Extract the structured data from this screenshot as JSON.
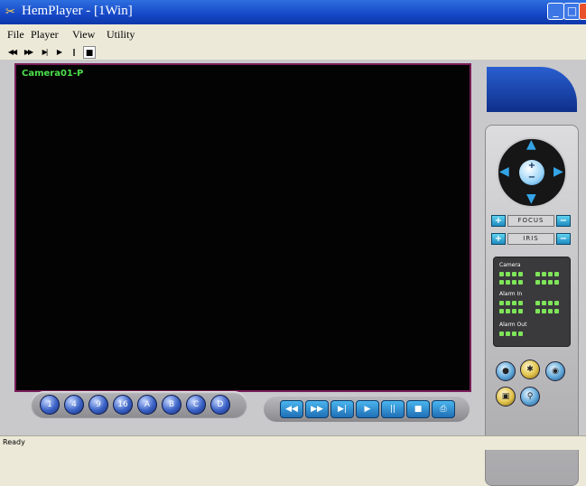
{
  "window": {
    "title": "HemPlayer - [1Win]",
    "min_label": "_",
    "max_label": "□",
    "close_label": "×"
  },
  "menu": [
    {
      "label": "File"
    },
    {
      "label": "Player"
    },
    {
      "label": "View"
    },
    {
      "label": "Utility"
    }
  ],
  "toolbar": {
    "rewind": "◀◀",
    "fast_forward": "▶▶",
    "step": "▶|",
    "play": "▶",
    "pause": "||",
    "stop": "■"
  },
  "video": {
    "camera_label": "Camera01-P"
  },
  "layout_buttons": [
    "1",
    "4",
    "9",
    "16",
    "A",
    "B",
    "C",
    "D"
  ],
  "playback": {
    "rewind": "◀◀",
    "fast_forward": "▶▶",
    "step": "▶|",
    "play": "▶",
    "pause": "||",
    "stop": "■",
    "snapshot": "⎙"
  },
  "ptz": {
    "zoom_center": "+\n−",
    "focus_label": "FOCUS",
    "iris_label": "IRIS",
    "plus": "+",
    "minus": "−"
  },
  "status_panel": {
    "camera_label": "Camera",
    "alarm_in_label": "Alarm In",
    "alarm_out_label": "Alarm Out",
    "led_color": "#7fe45a"
  },
  "statusbar": {
    "text": "Ready"
  },
  "colors": {
    "title_bar": "#1547c6",
    "video_background": "#030303",
    "video_border": "#7a1e5a",
    "camera_text": "#4be04b",
    "accent": "#34a4e6"
  }
}
